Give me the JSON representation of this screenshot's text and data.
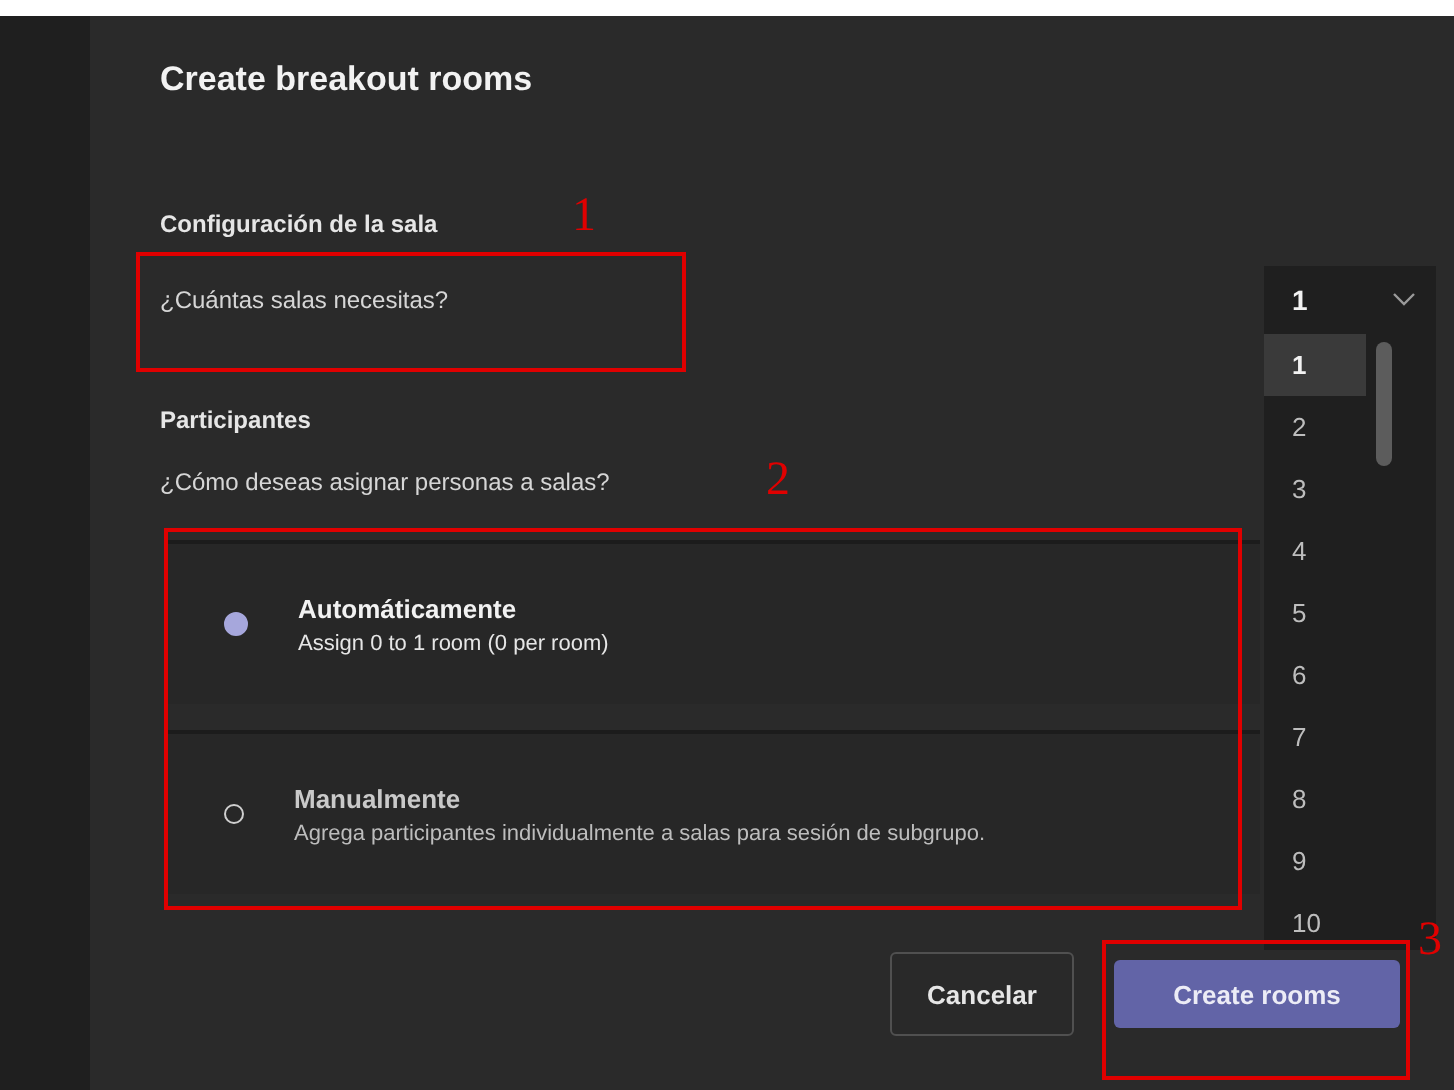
{
  "title": "Create breakout rooms",
  "room_config": {
    "heading": "Configuración de la sala",
    "question": "¿Cuántas salas necesitas?"
  },
  "participants": {
    "heading": "Participantes",
    "question": "¿Cómo deseas asignar personas a salas?",
    "options": [
      {
        "title": "Automáticamente",
        "description": "Assign 0 to 1 room (0 per room)",
        "selected": true
      },
      {
        "title": "Manualmente",
        "description": "Agrega participantes individualmente a salas para sesión de subgrupo.",
        "selected": false
      }
    ]
  },
  "room_count": {
    "value": "1",
    "expanded": true,
    "options": [
      {
        "label": "1",
        "selected": true
      },
      {
        "label": "2",
        "selected": false
      },
      {
        "label": "3",
        "selected": false
      },
      {
        "label": "4",
        "selected": false
      },
      {
        "label": "5",
        "selected": false
      },
      {
        "label": "6",
        "selected": false
      },
      {
        "label": "7",
        "selected": false
      },
      {
        "label": "8",
        "selected": false
      },
      {
        "label": "9",
        "selected": false
      },
      {
        "label": "10",
        "selected": false
      }
    ]
  },
  "buttons": [
    {
      "label": "Cancelar",
      "kind": "secondary"
    },
    {
      "label": "Create rooms",
      "kind": "primary"
    }
  ],
  "annotations": [
    {
      "label": "1"
    },
    {
      "label": "2"
    },
    {
      "label": "3"
    }
  ]
}
